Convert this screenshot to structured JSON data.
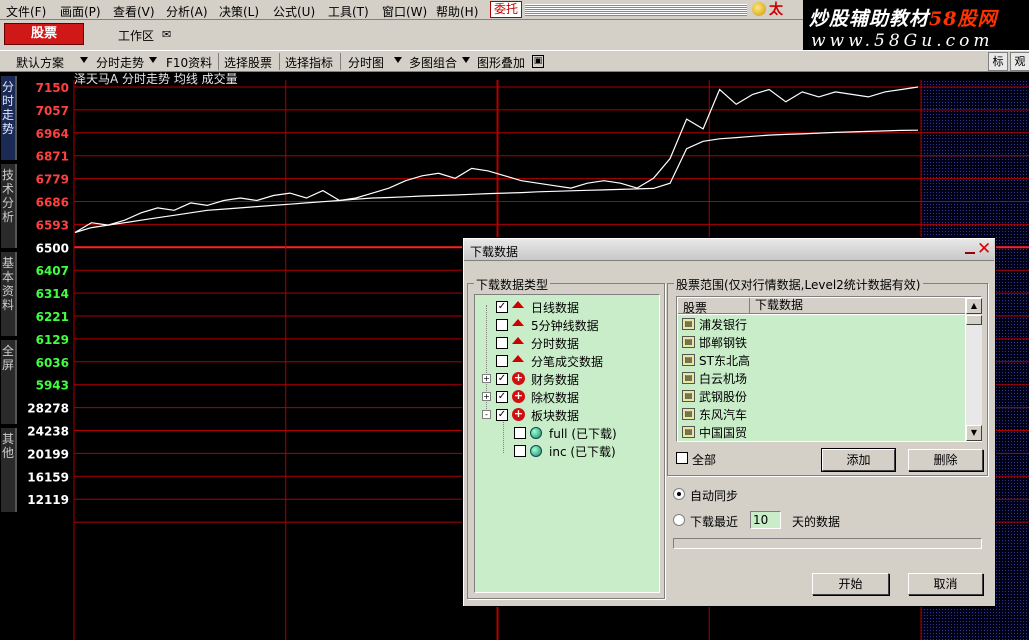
{
  "menubar": {
    "items": [
      "文件(F)",
      "画面(P)",
      "查看(V)",
      "分析(A)",
      "决策(L)",
      "公式(U)",
      "工具(T)",
      "窗口(W)",
      "帮助(H)"
    ],
    "entrust": "委托",
    "brand": "太"
  },
  "watermark": {
    "title_part1": "炒股辅助教材",
    "title_part2": "58股网",
    "url": "www.58Gu.com"
  },
  "secondbar": {
    "stock_button": "股票",
    "work_area": "工作区",
    "mail_icon": "mail-icon"
  },
  "toolbar": {
    "items": [
      "默认方案",
      "分时走势",
      "F10资料",
      "选择股票",
      "选择指标",
      "分时图",
      "多图组合",
      "图形叠加"
    ],
    "right_items": [
      "标",
      "观"
    ]
  },
  "sidetabs": [
    {
      "label": "分时走势",
      "active": true
    },
    {
      "label": "技术分析",
      "active": false
    },
    {
      "label": "基本资料",
      "active": false
    },
    {
      "label": "全屏",
      "active": false
    },
    {
      "label": "其他",
      "active": false
    }
  ],
  "chart_data": {
    "type": "line",
    "title": "泽天马A 分时走势 均线 成交量",
    "price_axis": {
      "ticks": [
        "7150",
        "7057",
        "6964",
        "6871",
        "6779",
        "6686",
        "6593",
        "6500",
        "6407",
        "6314",
        "6221",
        "6129",
        "6036",
        "5943"
      ],
      "ylim": [
        5943,
        7150
      ],
      "baseline": 6500
    },
    "volume_axis": {
      "ticks": [
        "28278",
        "24238",
        "20199",
        "16159",
        "12119"
      ]
    },
    "series": [
      {
        "name": "分时",
        "color": "#ffffff",
        "values": [
          6560,
          6600,
          6590,
          6610,
          6640,
          6660,
          6650,
          6680,
          6670,
          6690,
          6700,
          6690,
          6710,
          6720,
          6700,
          6730,
          6690,
          6700,
          6720,
          6740,
          6770,
          6790,
          6800,
          6780,
          6820,
          6810,
          6790,
          6770,
          6760,
          6750,
          6740,
          6760,
          6770,
          6760,
          6740,
          6780,
          6860,
          7020,
          6980,
          7140,
          7080,
          7120,
          7140,
          7090,
          7130,
          7110,
          7130,
          7120,
          7110,
          7130,
          7140,
          7150
        ]
      },
      {
        "name": "均线",
        "color": "#ffffff",
        "values": [
          6560,
          6580,
          6590,
          6600,
          6610,
          6620,
          6630,
          6640,
          6650,
          6655,
          6660,
          6665,
          6670,
          6675,
          6680,
          6685,
          6690,
          6695,
          6700,
          6702,
          6705,
          6708,
          6710,
          6712,
          6715,
          6718,
          6720,
          6722,
          6725,
          6727,
          6729,
          6731,
          6733,
          6735,
          6737,
          6739,
          6760,
          6900,
          6930,
          6940,
          6945,
          6950,
          6955,
          6958,
          6960,
          6963,
          6966,
          6968,
          6970,
          6972,
          6974,
          6975
        ]
      }
    ],
    "grid": true,
    "colors": {
      "up": "#ff4040",
      "down": "#40ff40",
      "grid": "#b00000"
    }
  },
  "dialog": {
    "title": "下载数据",
    "type_group_label": "下载数据类型",
    "type_tree": [
      {
        "label": "日线数据",
        "checked": true,
        "icon": "red-up-arrow-icon",
        "level": 0,
        "expander": ""
      },
      {
        "label": "5分钟线数据",
        "checked": false,
        "icon": "red-up-arrow-icon",
        "level": 0,
        "expander": ""
      },
      {
        "label": "分时数据",
        "checked": false,
        "icon": "red-up-arrow-icon",
        "level": 0,
        "expander": ""
      },
      {
        "label": "分笔成交数据",
        "checked": false,
        "icon": "red-up-arrow-icon",
        "level": 0,
        "expander": ""
      },
      {
        "label": "财务数据",
        "checked": true,
        "icon": "red-plus-icon",
        "level": 0,
        "expander": "+"
      },
      {
        "label": "除权数据",
        "checked": true,
        "icon": "red-plus-icon",
        "level": 0,
        "expander": "+"
      },
      {
        "label": "板块数据",
        "checked": true,
        "icon": "red-plus-icon",
        "level": 0,
        "expander": "-"
      },
      {
        "label": "full (已下载)",
        "checked": false,
        "icon": "green-ball-icon",
        "level": 1,
        "expander": ""
      },
      {
        "label": "inc (已下载)",
        "checked": false,
        "icon": "green-ball-icon",
        "level": 1,
        "expander": ""
      }
    ],
    "range_group_label": "股票范围(仅对行情数据,Level2统计数据有效)",
    "list_columns": [
      "股票",
      "下载数据"
    ],
    "stocks": [
      "浦发银行",
      "邯郸钢铁",
      "ST东北高",
      "白云机场",
      "武钢股份",
      "东风汽车",
      "中国国贸"
    ],
    "all_label": "全部",
    "all_checked": false,
    "add_button": "添加",
    "delete_button": "删除",
    "auto_sync_label": "自动同步",
    "recent_label": "下载最近",
    "days_value": "10",
    "days_suffix": "天的数据",
    "start_button": "开始",
    "cancel_button": "取消"
  }
}
